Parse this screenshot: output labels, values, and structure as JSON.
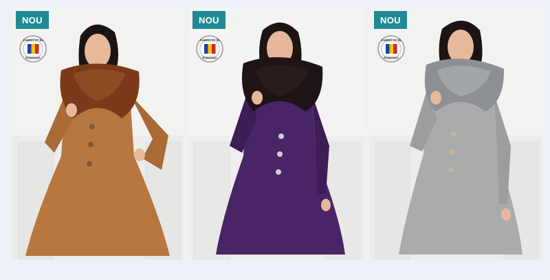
{
  "products": [
    {
      "badge": "NOU",
      "seal_text": [
        "FABRICAT ÎN",
        "ROMÂNIA"
      ],
      "coat_color": "#b8773f",
      "fur_color": "#7a3a1a"
    },
    {
      "badge": "NOU",
      "seal_text": [
        "FABRICAT ÎN",
        "ROMÂNIA"
      ],
      "coat_color": "#4a2566",
      "fur_color": "#1e1415"
    },
    {
      "badge": "NOU",
      "seal_text": [
        "FABRICAT ÎN",
        "ROMÂNIA"
      ],
      "coat_color": "#a9abad",
      "fur_color": "#8c8f93"
    }
  ],
  "colors": {
    "badge_bg": "#1f8a94",
    "badge_text": "#ffffff",
    "page_bg": "#eef2f8"
  }
}
